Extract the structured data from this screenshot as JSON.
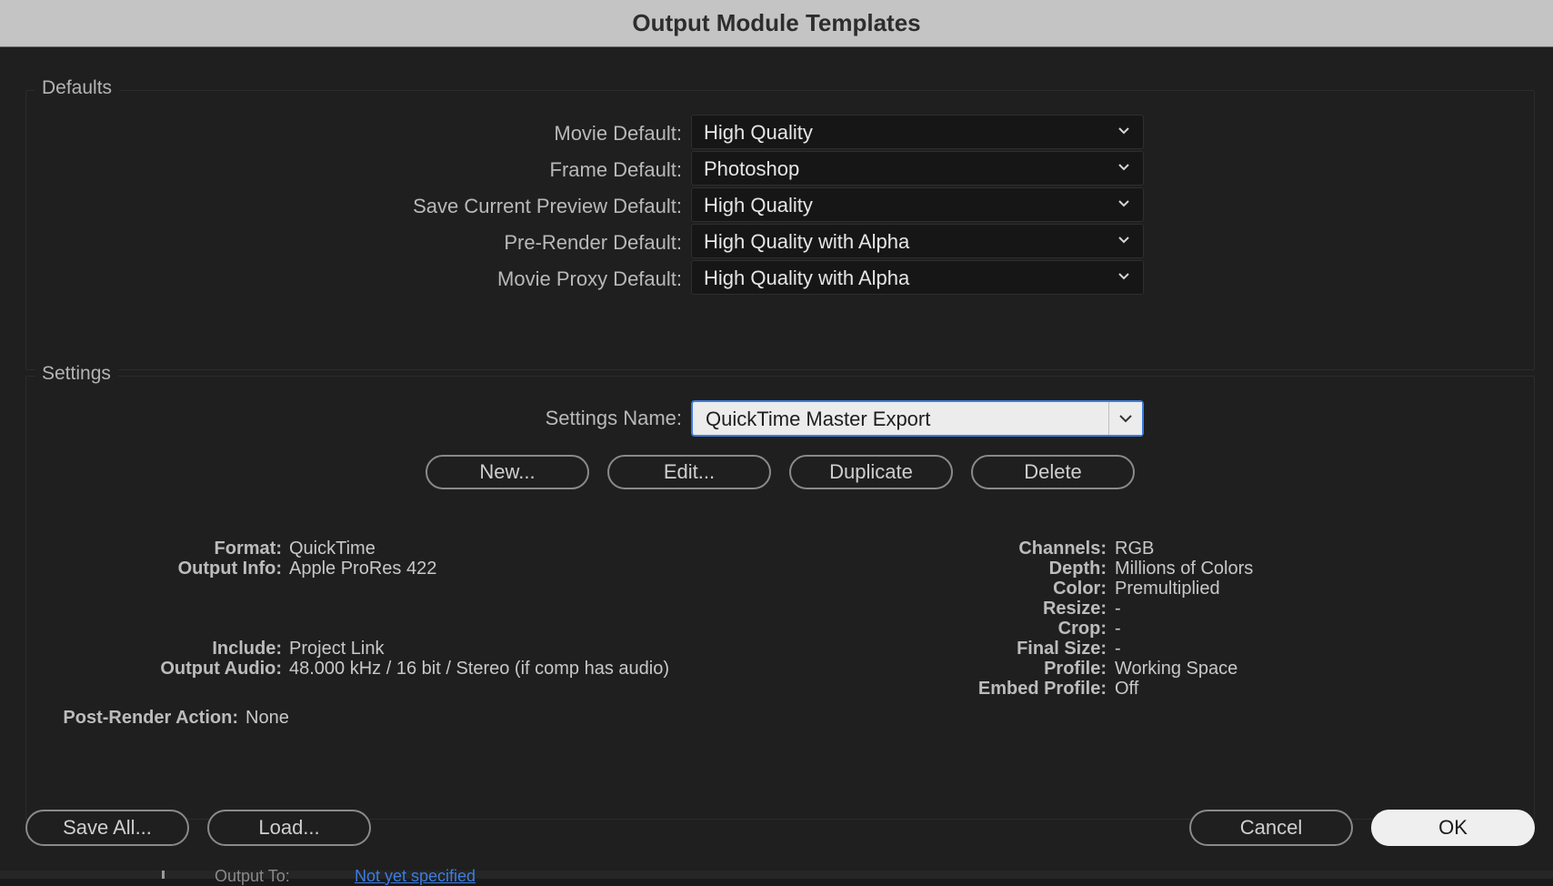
{
  "window": {
    "title": "Output Module Templates"
  },
  "defaults": {
    "group_label": "Defaults",
    "rows": [
      {
        "label": "Movie Default:",
        "value": "High Quality"
      },
      {
        "label": "Frame Default:",
        "value": "Photoshop"
      },
      {
        "label": "Save Current Preview Default:",
        "value": "High Quality"
      },
      {
        "label": "Pre-Render Default:",
        "value": "High Quality with Alpha"
      },
      {
        "label": "Movie Proxy Default:",
        "value": "High Quality with Alpha"
      }
    ]
  },
  "settings": {
    "group_label": "Settings",
    "name_label": "Settings Name:",
    "name_value": "QuickTime Master Export",
    "buttons": {
      "new": "New...",
      "edit": "Edit...",
      "duplicate": "Duplicate",
      "delete": "Delete"
    },
    "left_info": [
      {
        "key": "Format:",
        "value": "QuickTime"
      },
      {
        "key": "Output Info:",
        "value": "Apple ProRes 422"
      },
      {
        "key": "Include:",
        "value": "Project Link"
      },
      {
        "key": "Output Audio:",
        "value": "48.000 kHz / 16 bit / Stereo (if comp has audio)"
      }
    ],
    "post_render": {
      "key": "Post-Render Action:",
      "value": "None"
    },
    "right_info": [
      {
        "key": "Channels:",
        "value": "RGB"
      },
      {
        "key": "Depth:",
        "value": "Millions of Colors"
      },
      {
        "key": "Color:",
        "value": "Premultiplied"
      },
      {
        "key": "Resize:",
        "value": "-"
      },
      {
        "key": "Crop:",
        "value": "-"
      },
      {
        "key": "Final Size:",
        "value": "-"
      },
      {
        "key": "Profile:",
        "value": "Working Space"
      },
      {
        "key": "Embed Profile:",
        "value": "Off"
      }
    ]
  },
  "footer": {
    "save_all": "Save All...",
    "load": "Load...",
    "cancel": "Cancel",
    "ok": "OK"
  },
  "background_peek": {
    "label": "Output To:",
    "link": "Not yet specified"
  },
  "colors": {
    "accent": "#3b7de0",
    "background": "#1f1f1f",
    "titlebar": "#c4c4c4"
  }
}
